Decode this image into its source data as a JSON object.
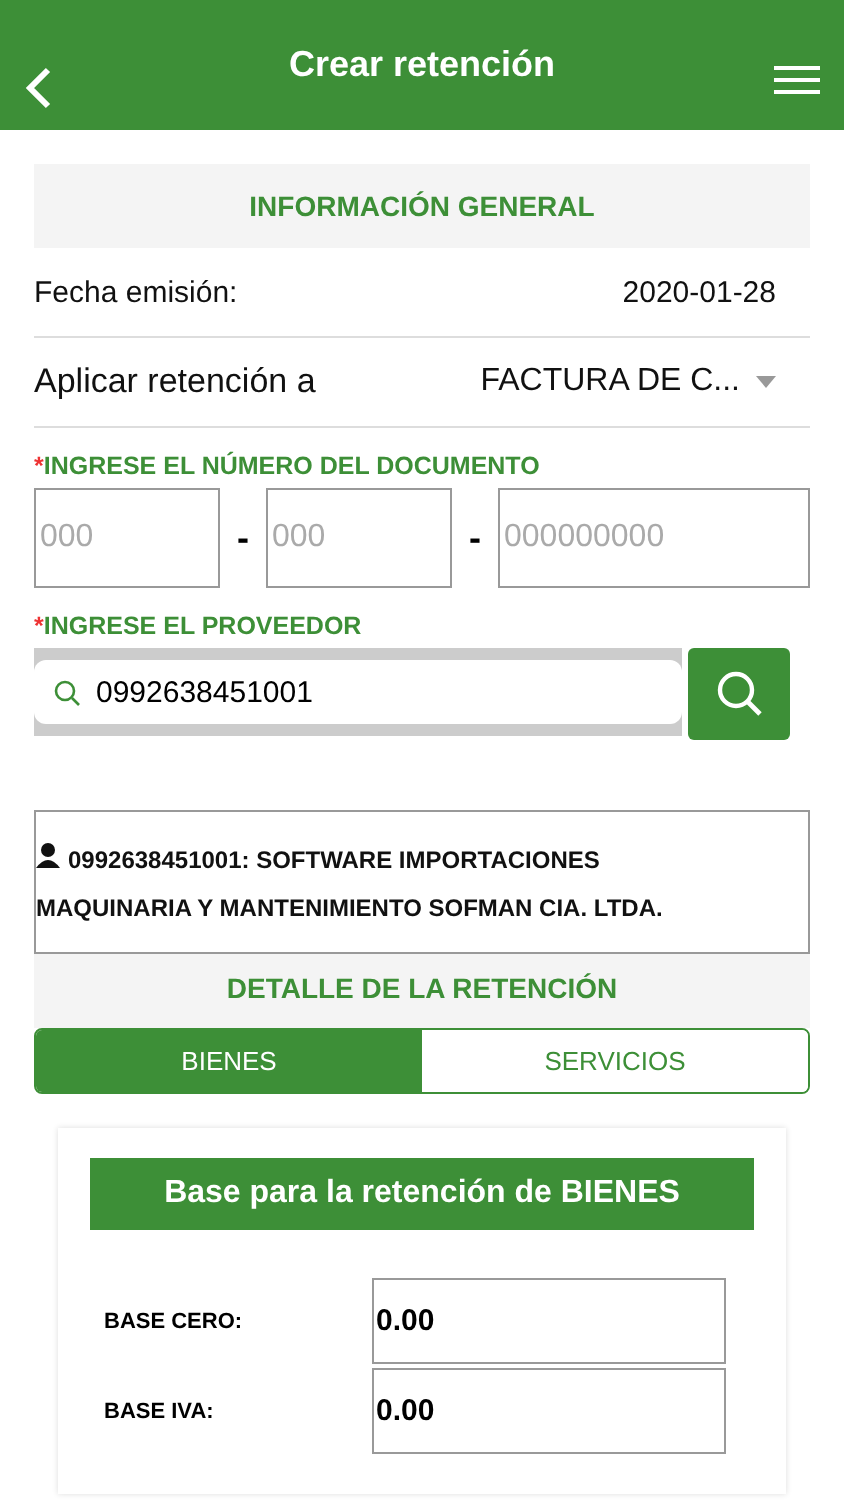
{
  "header": {
    "title": "Crear retención"
  },
  "general": {
    "title": "INFORMACIÓN GENERAL",
    "rows": [
      {
        "kind": "text",
        "label": "Fecha emisión:",
        "value": "2020-01-28"
      },
      {
        "kind": "select",
        "label": "Aplicar retención a",
        "value": "FACTURA DE C..."
      }
    ]
  },
  "document": {
    "required": "*",
    "label": "INGRESE EL NÚMERO DEL DOCUMENTO",
    "fields": [
      {
        "placeholder": "000"
      },
      {
        "placeholder": "000"
      },
      {
        "placeholder": "000000000"
      }
    ],
    "separators": [
      "-",
      "-"
    ]
  },
  "provider": {
    "required": "*",
    "label": "INGRESE EL PROVEEDOR",
    "search_value": "0992638451001",
    "result": "0992638451001: SOFTWARE IMPORTACIONES MAQUINARIA Y MANTENIMIENTO SOFMAN CIA. LTDA."
  },
  "detail": {
    "title": "DETALLE DE LA RETENCIÓN",
    "tabs": [
      {
        "label": "BIENES",
        "selected": true
      },
      {
        "label": "SERVICIOS",
        "selected": false
      }
    ]
  },
  "base_card": {
    "title": "Base para la retención de BIENES",
    "rows": [
      {
        "label": "BASE CERO:",
        "value": "0.00"
      },
      {
        "label": "BASE IVA:",
        "value": "0.00"
      }
    ]
  }
}
